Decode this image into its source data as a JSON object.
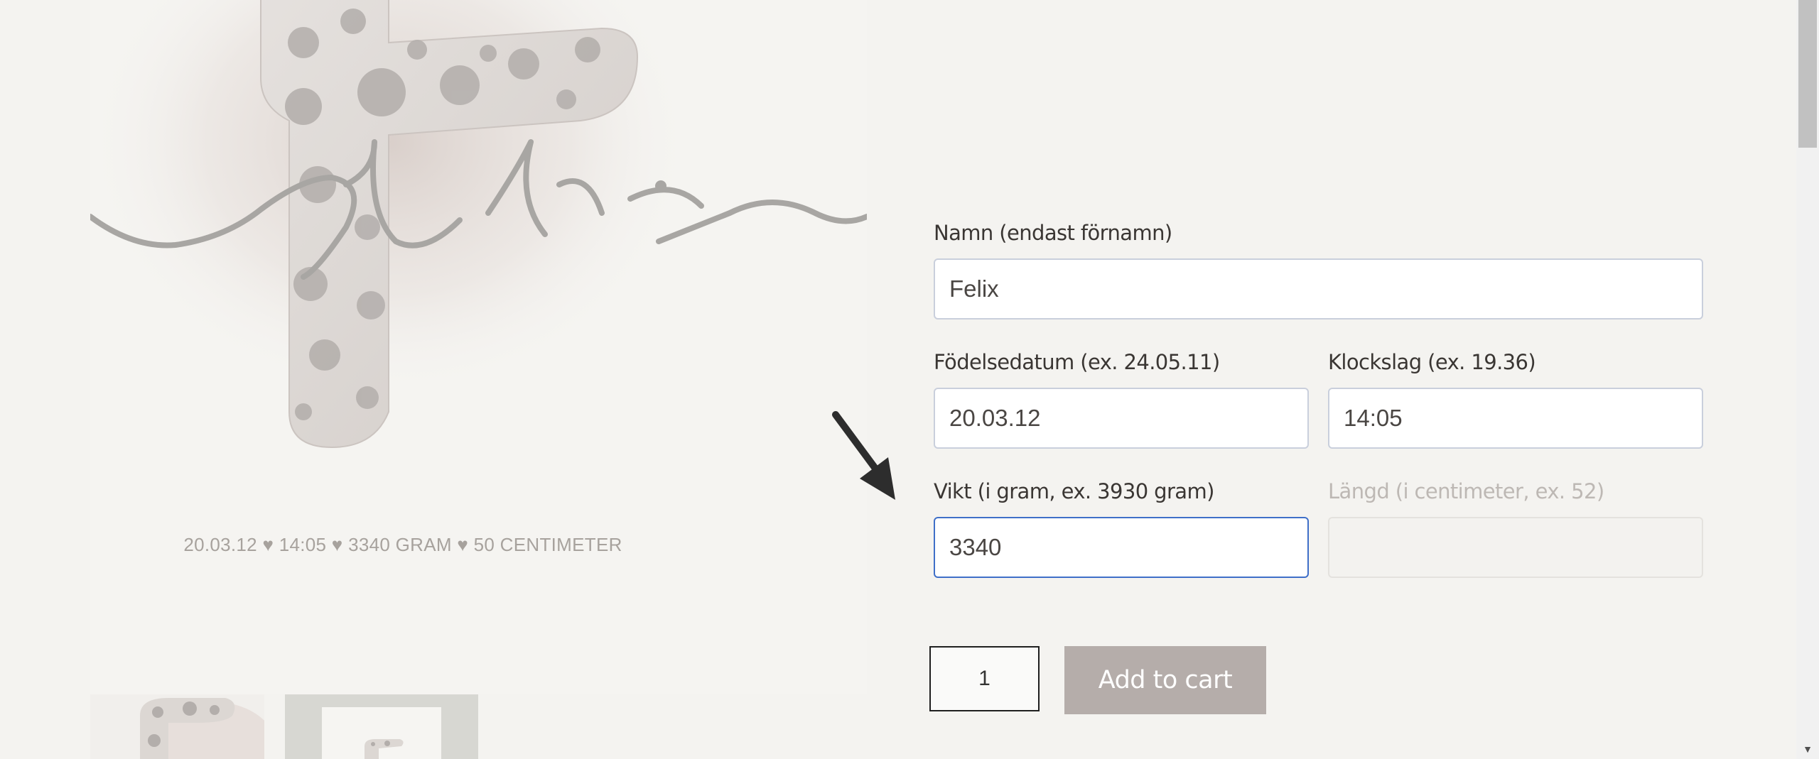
{
  "product": {
    "poster_details": "20.03.12 ♥ 14:05 ♥ 3340 GRAM ♥ 50 CENTIMETER"
  },
  "form": {
    "name": {
      "label": "Namn (endast förnamn)",
      "value": "Felix"
    },
    "birthdate": {
      "label": "Födelsedatum (ex. 24.05.11)",
      "value": "20.03.12"
    },
    "time": {
      "label": "Klockslag (ex. 19.36)",
      "value": "14:05"
    },
    "weight": {
      "label": "Vikt (i gram, ex. 3930 gram)",
      "value": "3340"
    },
    "length": {
      "label": "Längd (i centimeter, ex. 52)",
      "value": ""
    },
    "quantity": "1",
    "add_to_cart_label": "Add to cart"
  },
  "colors": {
    "focus_border": "#3f6fc8",
    "button_bg": "#b5adaa",
    "background": "#f4f3f0"
  },
  "icons": {
    "annotation": "arrow-pointer-icon",
    "scroll": "scroll-down-arrow-icon"
  }
}
